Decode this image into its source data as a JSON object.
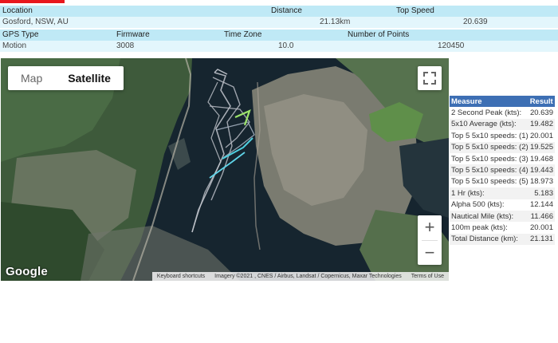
{
  "session": {
    "labels": {
      "location": "Location",
      "distance": "Distance",
      "top_speed": "Top Speed",
      "gps_type": "GPS Type",
      "firmware": "Firmware",
      "time_zone": "Time Zone",
      "num_points": "Number of Points"
    },
    "values": {
      "location": "Gosford, NSW, AU",
      "distance": "21.13km",
      "top_speed": "20.639",
      "gps_type": "Motion",
      "firmware": "3008",
      "time_zone": "10.0",
      "num_points": "120450"
    }
  },
  "map": {
    "type_tabs": [
      "Map",
      "Satellite"
    ],
    "active_tab": "Satellite",
    "zoom_in": "+",
    "zoom_out": "−",
    "logo": "Google",
    "attribution": {
      "shortcuts": "Keyboard shortcuts",
      "imagery": "Imagery ©2021 , CNES / Airbus, Landsat / Copernicus, Maxar Technologies",
      "terms": "Terms of Use"
    },
    "icons": [
      "fullscreen-icon"
    ]
  },
  "stats": {
    "headers": [
      "Measure",
      "Result"
    ],
    "rows": [
      [
        "2 Second Peak (kts):",
        "20.639"
      ],
      [
        "5x10 Average (kts):",
        "19.482"
      ],
      [
        "Top 5 5x10 speeds: (1)",
        "20.001"
      ],
      [
        "Top 5 5x10 speeds: (2)",
        "19.525"
      ],
      [
        "Top 5 5x10 speeds: (3)",
        "19.468"
      ],
      [
        "Top 5 5x10 speeds: (4)",
        "19.443"
      ],
      [
        "Top 5 5x10 speeds: (5)",
        "18.973"
      ],
      [
        "1 Hr (kts):",
        "5.183"
      ],
      [
        "Alpha 500 (kts):",
        "12.144"
      ],
      [
        "Nautical Mile (kts):",
        "11.466"
      ],
      [
        "100m peak (kts):",
        "20.001"
      ],
      [
        "Total Distance (km):",
        "21.131"
      ]
    ]
  },
  "colors": {
    "header_row": "#bfe9f6",
    "value_row": "#e3f6fc",
    "table_header": "#3d6fb4",
    "accent_bar": "#e8181e",
    "track_fast": "#4fd0e0",
    "track_slow": "#b8bcc4"
  }
}
